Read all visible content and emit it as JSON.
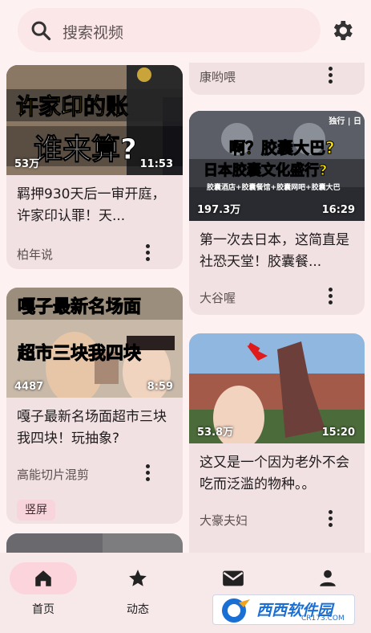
{
  "search": {
    "placeholder": "搜索视频"
  },
  "cards_left": [
    {
      "views": "53万",
      "duration": "11:53",
      "title": "羁押930天后一审开庭，许家印认罪！天...",
      "author": "柏年说",
      "overlay_top": "许家印的账",
      "overlay_bottom": "谁来算?"
    },
    {
      "views": "4487",
      "duration": "8:59",
      "title": "嘎子最新名场面超市三块我四块！玩抽象?",
      "author": "高能切片混剪",
      "tag": "竖屏",
      "overlay_top": "嘎子最新名场面",
      "overlay_bottom": "超市三块我四块"
    }
  ],
  "cards_right": [
    {
      "author": "康哟喂"
    },
    {
      "views": "197.3万",
      "duration": "16:29",
      "title": "第一次去日本，这简直是社恐天堂！胶囊餐...",
      "author": "大谷喔",
      "overlay_top": "啊？胶囊大巴?",
      "overlay_mid": "日本胶囊文化盛行?",
      "overlay_bottom": "胶囊酒店+胶囊餐馆+胶囊网吧+胶囊大巴",
      "corner": "独行 | 日"
    },
    {
      "views": "53.8万",
      "duration": "15:20",
      "title": "这又是一个因为老外不会吃而泛滥的物种。。",
      "author": "大豪夫妇"
    }
  ],
  "nav": [
    {
      "label": "首页",
      "icon": "home-icon"
    },
    {
      "label": "动态",
      "icon": "star-icon"
    },
    {
      "label": "消息",
      "icon": "mail-icon"
    },
    {
      "label": "",
      "icon": "person-icon"
    }
  ],
  "watermark": {
    "text": "西西软件园",
    "sub": "CR173.COM"
  },
  "colors": {
    "background": "#fdf1f2",
    "card": "#f2e1e3",
    "active_pill": "#fbd4dc",
    "yellow_text": "#ffe600"
  }
}
